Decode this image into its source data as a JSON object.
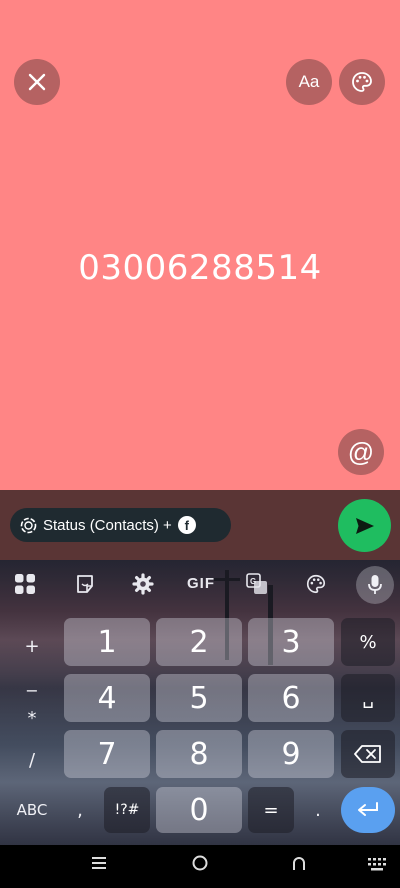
{
  "composer": {
    "background": "#ff8585",
    "status_text": "03006288514",
    "font_button_label": "Aa",
    "mention_symbol": "@"
  },
  "audience_chip": {
    "label": "Status (Contacts) +",
    "fb_glyph": "f"
  },
  "keyboard": {
    "toolbar": {
      "gif_label": "GIF"
    },
    "left_column": [
      "+",
      "−",
      "*",
      "/"
    ],
    "digits": [
      "1",
      "2",
      "3",
      "4",
      "5",
      "6",
      "7",
      "8",
      "9",
      "0"
    ],
    "right_column": {
      "percent": "%",
      "space": "␣"
    },
    "bottom_row": {
      "abc": "ABC",
      "comma": ",",
      "symbols": "!?#",
      "equals": "=",
      "period": "."
    }
  },
  "colors": {
    "send": "#1fbd60",
    "enter": "#5aa0f0"
  }
}
